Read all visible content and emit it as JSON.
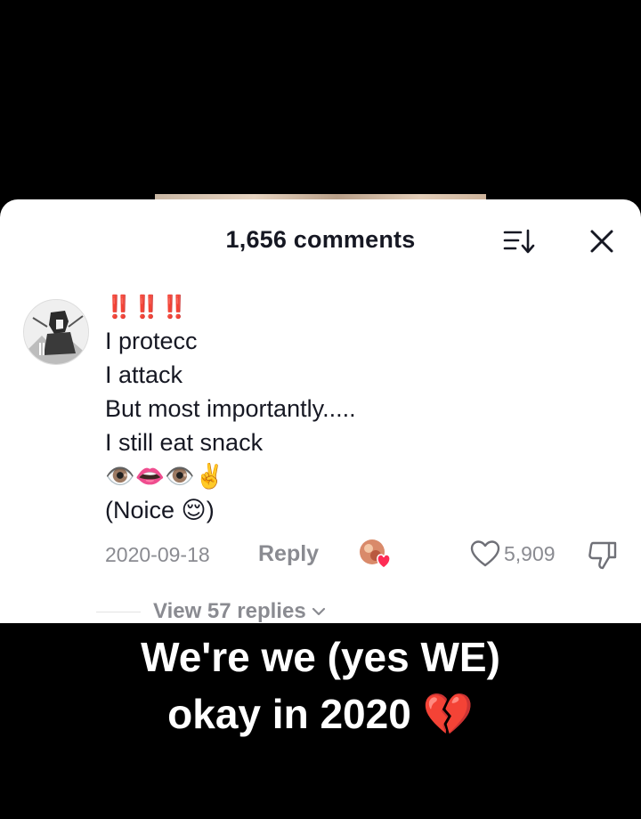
{
  "header": {
    "title": "1,656 comments"
  },
  "comment": {
    "emoji_top": "‼️‼️‼️",
    "lines": [
      "I protecc",
      "I attack",
      "But most importantly.....",
      "I still eat snack"
    ],
    "emoji_row": "👁️👄👁️✌️",
    "last_line_prefix": "(Noice ",
    "last_line_emoji": "😌",
    "last_line_suffix": ")",
    "date": "2020-09-18",
    "reply_label": "Reply",
    "like_count": "5,909",
    "liked_by_creator": true
  },
  "replies": {
    "label": "View 57 replies"
  },
  "caption": {
    "line1": "We're we (yes WE)",
    "line2": "okay in 2020",
    "emoji": "💔"
  },
  "icons": {
    "sort": "sort-icon",
    "close": "close-icon",
    "like": "heart-outline-icon",
    "dislike": "thumbs-down-icon",
    "chevron": "chevron-down-icon",
    "creator_like": "creator-heart-icon"
  },
  "colors": {
    "text": "#161823",
    "muted": "#8a8b91",
    "heart_red": "#fe2c55",
    "background": "#000000",
    "sheet": "#ffffff"
  }
}
